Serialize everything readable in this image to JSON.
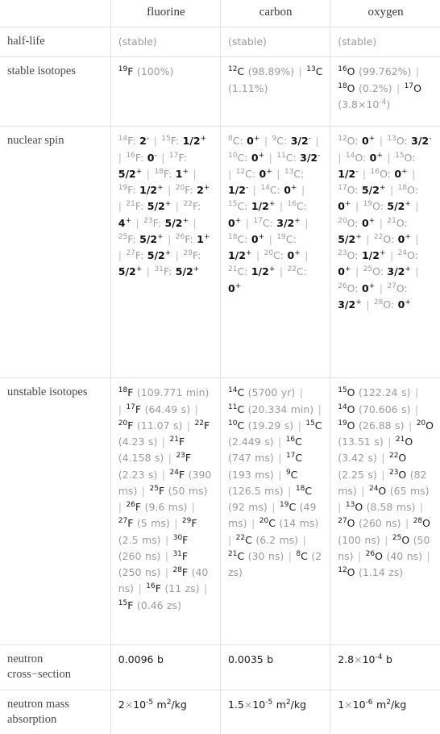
{
  "table": {
    "columns": [
      "fluorine",
      "carbon",
      "oxygen"
    ],
    "corner_label": "",
    "rows": [
      {
        "label": "half-life",
        "cells": [
          {
            "parts": [
              {
                "t": "(stable)",
                "s": "mut"
              }
            ]
          },
          {
            "parts": [
              {
                "t": "(stable)",
                "s": "mut"
              }
            ]
          },
          {
            "parts": [
              {
                "t": "(stable)",
                "s": "mut"
              }
            ]
          }
        ]
      },
      {
        "label": "stable isotopes",
        "cells": [
          {
            "parts": [
              {
                "t": "19",
                "s": "sup-dark"
              },
              {
                "t": "F",
                "s": "dark"
              },
              {
                "t": " (100%)",
                "s": "mut"
              }
            ]
          },
          {
            "parts": [
              {
                "t": "12",
                "s": "sup-dark"
              },
              {
                "t": "C",
                "s": "dark"
              },
              {
                "t": " (98.89%)",
                "s": "mut"
              },
              {
                "t": "|",
                "s": "sep"
              },
              {
                "t": "13",
                "s": "sup-dark"
              },
              {
                "t": "C",
                "s": "dark"
              },
              {
                "t": " (1.11%)",
                "s": "mut"
              }
            ]
          },
          {
            "parts": [
              {
                "t": "16",
                "s": "sup-dark"
              },
              {
                "t": "O",
                "s": "dark"
              },
              {
                "t": " (99.762%)",
                "s": "mut"
              },
              {
                "t": "|",
                "s": "sep"
              },
              {
                "t": "18",
                "s": "sup-dark"
              },
              {
                "t": "O",
                "s": "dark"
              },
              {
                "t": " (0.2%)",
                "s": "mut"
              },
              {
                "t": "|",
                "s": "sep"
              },
              {
                "t": "17",
                "s": "sup-dark"
              },
              {
                "t": "O",
                "s": "dark"
              },
              {
                "t": " (3.8×10",
                "s": "mut"
              },
              {
                "t": "-4",
                "s": "sup-mut"
              },
              {
                "t": ")",
                "s": "mut"
              }
            ]
          }
        ]
      },
      {
        "label": "nuclear spin",
        "cells": [
          {
            "spins": [
              {
                "a": "14",
                "el": "F",
                "v": "2",
                "sign": "-"
              },
              {
                "a": "15",
                "el": "F",
                "v": "1/2",
                "sign": "+"
              },
              {
                "a": "16",
                "el": "F",
                "v": "0",
                "sign": "-"
              },
              {
                "a": "17",
                "el": "F",
                "v": "5/2",
                "sign": "+"
              },
              {
                "a": "18",
                "el": "F",
                "v": "1",
                "sign": "+"
              },
              {
                "a": "19",
                "el": "F",
                "v": "1/2",
                "sign": "+"
              },
              {
                "a": "20",
                "el": "F",
                "v": "2",
                "sign": "+"
              },
              {
                "a": "21",
                "el": "F",
                "v": "5/2",
                "sign": "+"
              },
              {
                "a": "22",
                "el": "F",
                "v": "4",
                "sign": "+"
              },
              {
                "a": "23",
                "el": "F",
                "v": "5/2",
                "sign": "+"
              },
              {
                "a": "25",
                "el": "F",
                "v": "5/2",
                "sign": "+"
              },
              {
                "a": "26",
                "el": "F",
                "v": "1",
                "sign": "+"
              },
              {
                "a": "27",
                "el": "F",
                "v": "5/2",
                "sign": "+"
              },
              {
                "a": "29",
                "el": "F",
                "v": "5/2",
                "sign": "+"
              },
              {
                "a": "31",
                "el": "F",
                "v": "5/2",
                "sign": "+"
              }
            ]
          },
          {
            "spins": [
              {
                "a": "8",
                "el": "C",
                "v": "0",
                "sign": "+"
              },
              {
                "a": "9",
                "el": "C",
                "v": "3/2",
                "sign": "-"
              },
              {
                "a": "10",
                "el": "C",
                "v": "0",
                "sign": "+"
              },
              {
                "a": "11",
                "el": "C",
                "v": "3/2",
                "sign": "-"
              },
              {
                "a": "12",
                "el": "C",
                "v": "0",
                "sign": "+"
              },
              {
                "a": "13",
                "el": "C",
                "v": "1/2",
                "sign": "-"
              },
              {
                "a": "14",
                "el": "C",
                "v": "0",
                "sign": "+"
              },
              {
                "a": "15",
                "el": "C",
                "v": "1/2",
                "sign": "+"
              },
              {
                "a": "16",
                "el": "C",
                "v": "0",
                "sign": "+"
              },
              {
                "a": "17",
                "el": "C",
                "v": "3/2",
                "sign": "+"
              },
              {
                "a": "18",
                "el": "C",
                "v": "0",
                "sign": "+"
              },
              {
                "a": "19",
                "el": "C",
                "v": "1/2",
                "sign": "+"
              },
              {
                "a": "20",
                "el": "C",
                "v": "0",
                "sign": "+"
              },
              {
                "a": "21",
                "el": "C",
                "v": "1/2",
                "sign": "+"
              },
              {
                "a": "22",
                "el": "C",
                "v": "0",
                "sign": "+"
              }
            ]
          },
          {
            "spins": [
              {
                "a": "12",
                "el": "O",
                "v": "0",
                "sign": "+"
              },
              {
                "a": "13",
                "el": "O",
                "v": "3/2",
                "sign": "-"
              },
              {
                "a": "14",
                "el": "O",
                "v": "0",
                "sign": "+"
              },
              {
                "a": "15",
                "el": "O",
                "v": "1/2",
                "sign": "-"
              },
              {
                "a": "16",
                "el": "O",
                "v": "0",
                "sign": "+"
              },
              {
                "a": "17",
                "el": "O",
                "v": "5/2",
                "sign": "+"
              },
              {
                "a": "18",
                "el": "O",
                "v": "0",
                "sign": "+"
              },
              {
                "a": "19",
                "el": "O",
                "v": "5/2",
                "sign": "+"
              },
              {
                "a": "20",
                "el": "O",
                "v": "0",
                "sign": "+"
              },
              {
                "a": "21",
                "el": "O",
                "v": "5/2",
                "sign": "+"
              },
              {
                "a": "22",
                "el": "O",
                "v": "0",
                "sign": "+"
              },
              {
                "a": "23",
                "el": "O",
                "v": "1/2",
                "sign": "+"
              },
              {
                "a": "24",
                "el": "O",
                "v": "0",
                "sign": "+"
              },
              {
                "a": "25",
                "el": "O",
                "v": "3/2",
                "sign": "+"
              },
              {
                "a": "26",
                "el": "O",
                "v": "0",
                "sign": "+"
              },
              {
                "a": "27",
                "el": "O",
                "v": "3/2",
                "sign": "+"
              },
              {
                "a": "28",
                "el": "O",
                "v": "0",
                "sign": "+"
              }
            ]
          }
        ]
      },
      {
        "label": "unstable isotopes",
        "cells": [
          {
            "isotopes": [
              {
                "a": "18",
                "el": "F",
                "hl": "109.771 min"
              },
              {
                "a": "17",
                "el": "F",
                "hl": "64.49 s"
              },
              {
                "a": "20",
                "el": "F",
                "hl": "11.07 s"
              },
              {
                "a": "22",
                "el": "F",
                "hl": "4.23 s"
              },
              {
                "a": "21",
                "el": "F",
                "hl": "4.158 s"
              },
              {
                "a": "23",
                "el": "F",
                "hl": "2.23 s"
              },
              {
                "a": "24",
                "el": "F",
                "hl": "390 ms"
              },
              {
                "a": "25",
                "el": "F",
                "hl": "50 ms"
              },
              {
                "a": "26",
                "el": "F",
                "hl": "9.6 ms"
              },
              {
                "a": "27",
                "el": "F",
                "hl": "5 ms"
              },
              {
                "a": "29",
                "el": "F",
                "hl": "2.5 ms"
              },
              {
                "a": "30",
                "el": "F",
                "hl": "260 ns"
              },
              {
                "a": "31",
                "el": "F",
                "hl": "250 ns"
              },
              {
                "a": "28",
                "el": "F",
                "hl": "40 ns"
              },
              {
                "a": "16",
                "el": "F",
                "hl": "11 zs"
              },
              {
                "a": "15",
                "el": "F",
                "hl": "0.46 zs"
              }
            ]
          },
          {
            "isotopes": [
              {
                "a": "14",
                "el": "C",
                "hl": "5700 yr"
              },
              {
                "a": "11",
                "el": "C",
                "hl": "20.334 min"
              },
              {
                "a": "10",
                "el": "C",
                "hl": "19.29 s"
              },
              {
                "a": "15",
                "el": "C",
                "hl": "2.449 s"
              },
              {
                "a": "16",
                "el": "C",
                "hl": "747 ms"
              },
              {
                "a": "17",
                "el": "C",
                "hl": "193 ms"
              },
              {
                "a": "9",
                "el": "C",
                "hl": "126.5 ms"
              },
              {
                "a": "18",
                "el": "C",
                "hl": "92 ms"
              },
              {
                "a": "19",
                "el": "C",
                "hl": "49 ms"
              },
              {
                "a": "20",
                "el": "C",
                "hl": "14 ms"
              },
              {
                "a": "22",
                "el": "C",
                "hl": "6.2 ms"
              },
              {
                "a": "21",
                "el": "C",
                "hl": "30 ns"
              },
              {
                "a": "8",
                "el": "C",
                "hl": "2 zs"
              }
            ]
          },
          {
            "isotopes": [
              {
                "a": "15",
                "el": "O",
                "hl": "122.24 s"
              },
              {
                "a": "14",
                "el": "O",
                "hl": "70.606 s"
              },
              {
                "a": "19",
                "el": "O",
                "hl": "26.88 s"
              },
              {
                "a": "20",
                "el": "O",
                "hl": "13.51 s"
              },
              {
                "a": "21",
                "el": "O",
                "hl": "3.42 s"
              },
              {
                "a": "22",
                "el": "O",
                "hl": "2.25 s"
              },
              {
                "a": "23",
                "el": "O",
                "hl": "82 ms"
              },
              {
                "a": "24",
                "el": "O",
                "hl": "65 ms"
              },
              {
                "a": "13",
                "el": "O",
                "hl": "8.58 ms"
              },
              {
                "a": "27",
                "el": "O",
                "hl": "260 ns"
              },
              {
                "a": "28",
                "el": "O",
                "hl": "100 ns"
              },
              {
                "a": "25",
                "el": "O",
                "hl": "50 ns"
              },
              {
                "a": "26",
                "el": "O",
                "hl": "40 ns"
              },
              {
                "a": "12",
                "el": "O",
                "hl": "1.14 zs"
              }
            ]
          }
        ]
      },
      {
        "label": "neutron cross−section",
        "cells": [
          {
            "parts": [
              {
                "t": "0.0096 b",
                "s": "dark"
              }
            ]
          },
          {
            "parts": [
              {
                "t": "0.0035 b",
                "s": "dark"
              }
            ]
          },
          {
            "parts": [
              {
                "t": "2.8",
                "s": "dark"
              },
              {
                "t": "×",
                "s": "mut"
              },
              {
                "t": "10",
                "s": "dark"
              },
              {
                "t": "-4",
                "s": "sup-dark"
              },
              {
                "t": " b",
                "s": "dark"
              }
            ]
          }
        ]
      },
      {
        "label": "neutron mass absorption",
        "cells": [
          {
            "parts": [
              {
                "t": "2",
                "s": "dark"
              },
              {
                "t": "×",
                "s": "mut"
              },
              {
                "t": "10",
                "s": "dark"
              },
              {
                "t": "-5",
                "s": "sup-dark"
              },
              {
                "t": " m",
                "s": "dark"
              },
              {
                "t": "2",
                "s": "sup-dark"
              },
              {
                "t": "/kg",
                "s": "dark"
              }
            ]
          },
          {
            "parts": [
              {
                "t": "1.5",
                "s": "dark"
              },
              {
                "t": "×",
                "s": "mut"
              },
              {
                "t": "10",
                "s": "dark"
              },
              {
                "t": "-5",
                "s": "sup-dark"
              },
              {
                "t": " m",
                "s": "dark"
              },
              {
                "t": "2",
                "s": "sup-dark"
              },
              {
                "t": "/kg",
                "s": "dark"
              }
            ]
          },
          {
            "parts": [
              {
                "t": "1",
                "s": "dark"
              },
              {
                "t": "×",
                "s": "mut"
              },
              {
                "t": "10",
                "s": "dark"
              },
              {
                "t": "-6",
                "s": "sup-dark"
              },
              {
                "t": " m",
                "s": "dark"
              },
              {
                "t": "2",
                "s": "sup-dark"
              },
              {
                "t": "/kg",
                "s": "dark"
              }
            ]
          }
        ]
      }
    ]
  }
}
